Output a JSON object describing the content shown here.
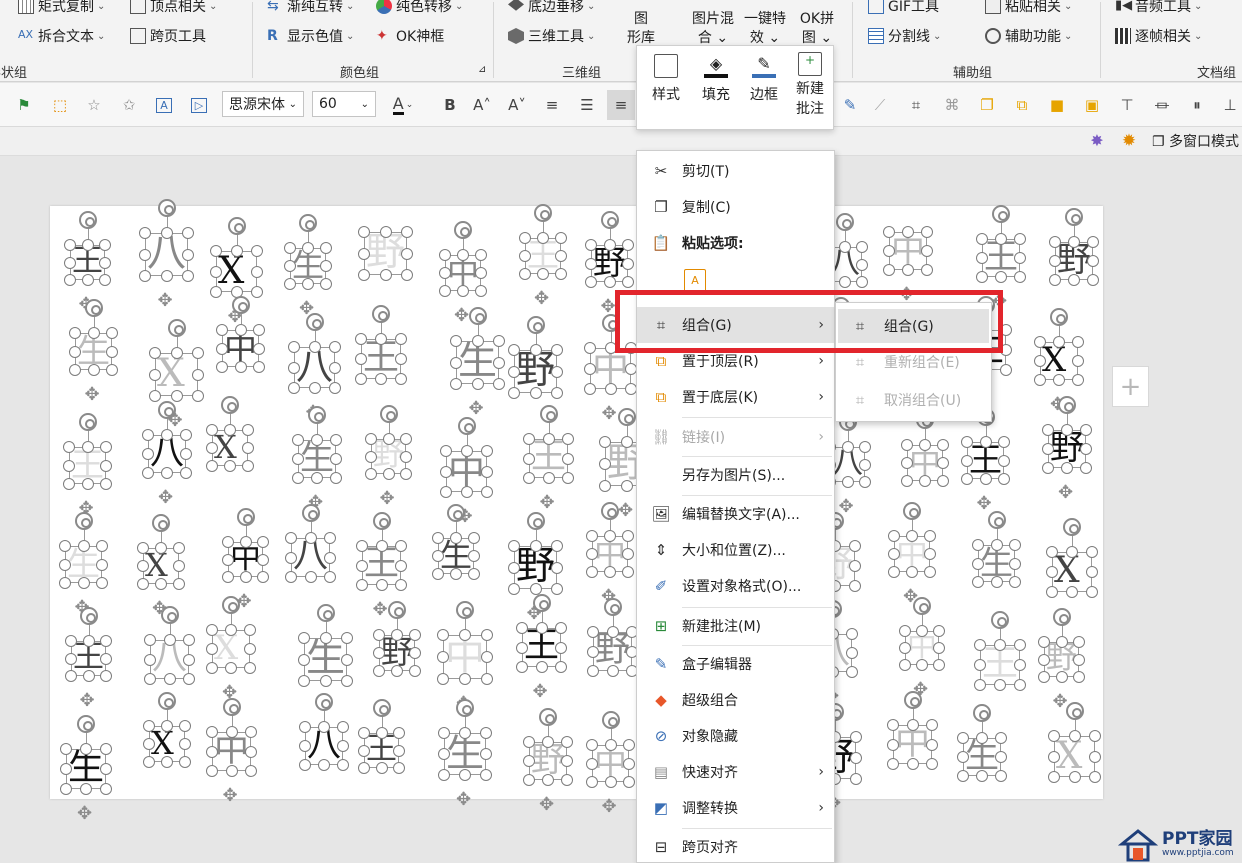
{
  "ribbon": {
    "row1": [
      {
        "label": "矩式复制",
        "chev": "⌄"
      },
      {
        "label": "顶点相关",
        "chev": "⌄"
      },
      {
        "label": "渐纯互转",
        "chev": "⌄"
      },
      {
        "label": "纯色转移",
        "chev": "⌄"
      },
      {
        "label": "底边垂移",
        "chev": "⌄"
      },
      {
        "label": "GIF工具",
        "chev": ""
      },
      {
        "label": "粘贴相关",
        "chev": "⌄"
      },
      {
        "label": "音频工具",
        "chev": "⌄"
      }
    ],
    "row2": [
      {
        "label": "拆合文本",
        "chev": "⌄"
      },
      {
        "label": "跨页工具",
        "chev": ""
      },
      {
        "label": "显示色值",
        "chev": "⌄"
      },
      {
        "label": "OK神框",
        "chev": ""
      },
      {
        "label": "三维工具",
        "chev": "⌄"
      },
      {
        "label": "分割线",
        "chev": "⌄"
      },
      {
        "label": "辅助功能",
        "chev": "⌄"
      },
      {
        "label": "逐帧相关",
        "chev": "⌄"
      }
    ],
    "big": {
      "tuxingku": [
        "图",
        "形库"
      ],
      "tupianhun": [
        "图片混",
        "合 ⌄"
      ],
      "yijiante": [
        "一键特",
        "效 ⌄"
      ],
      "okpin": [
        "OK拼",
        "图 ⌄"
      ]
    },
    "groups": [
      "形状组",
      "颜色组",
      "三维组",
      "辅助组",
      "文档组"
    ]
  },
  "toolbar": {
    "font_name": "思源宋体",
    "font_size": "60",
    "bold": "B",
    "grow": "A˄",
    "shrink": "A˅",
    "font_color": "A"
  },
  "subbar": {
    "multiwindow": "多窗口模式"
  },
  "minibar": {
    "items": [
      "样式",
      "填充",
      "边框",
      [
        "新建",
        "批注"
      ]
    ]
  },
  "context_menu": {
    "cut": "剪切(T)",
    "copy": "复制(C)",
    "paste_options": "粘贴选项:",
    "group": "组合(G)",
    "bring_front": "置于顶层(R)",
    "send_back": "置于底层(K)",
    "link": "链接(I)",
    "save_as_picture": "另存为图片(S)...",
    "edit_alt_text": "编辑替换文字(A)...",
    "size_position": "大小和位置(Z)...",
    "format_object": "设置对象格式(O)...",
    "new_comment": "新建批注(M)",
    "box_editor": "盒子编辑器",
    "super_group": "超级组合",
    "hide_object": "对象隐藏",
    "quick_align": "快速对齐",
    "adjust_convert": "调整转换",
    "cross_page_align": "跨页对齐"
  },
  "submenu": {
    "group": "组合(G)",
    "regroup": "重新组合(E)",
    "ungroup": "取消组合(U)"
  },
  "slide_chars": [
    "王",
    "八",
    "X",
    "生",
    "野",
    "中",
    "王",
    "野",
    "X",
    "生",
    "八",
    "中",
    "王",
    "野",
    "生",
    "X",
    "中",
    "八",
    "王",
    "生",
    "野",
    "中",
    "八",
    "王",
    "野",
    "中",
    "生",
    "X"
  ],
  "watermark": {
    "brand": "PPT家园",
    "url": "www.pptjia.com"
  },
  "colors": {
    "highlight": "#e2252c",
    "brand_blue": "#1f3f7a",
    "brand_orange": "#e8572a"
  }
}
